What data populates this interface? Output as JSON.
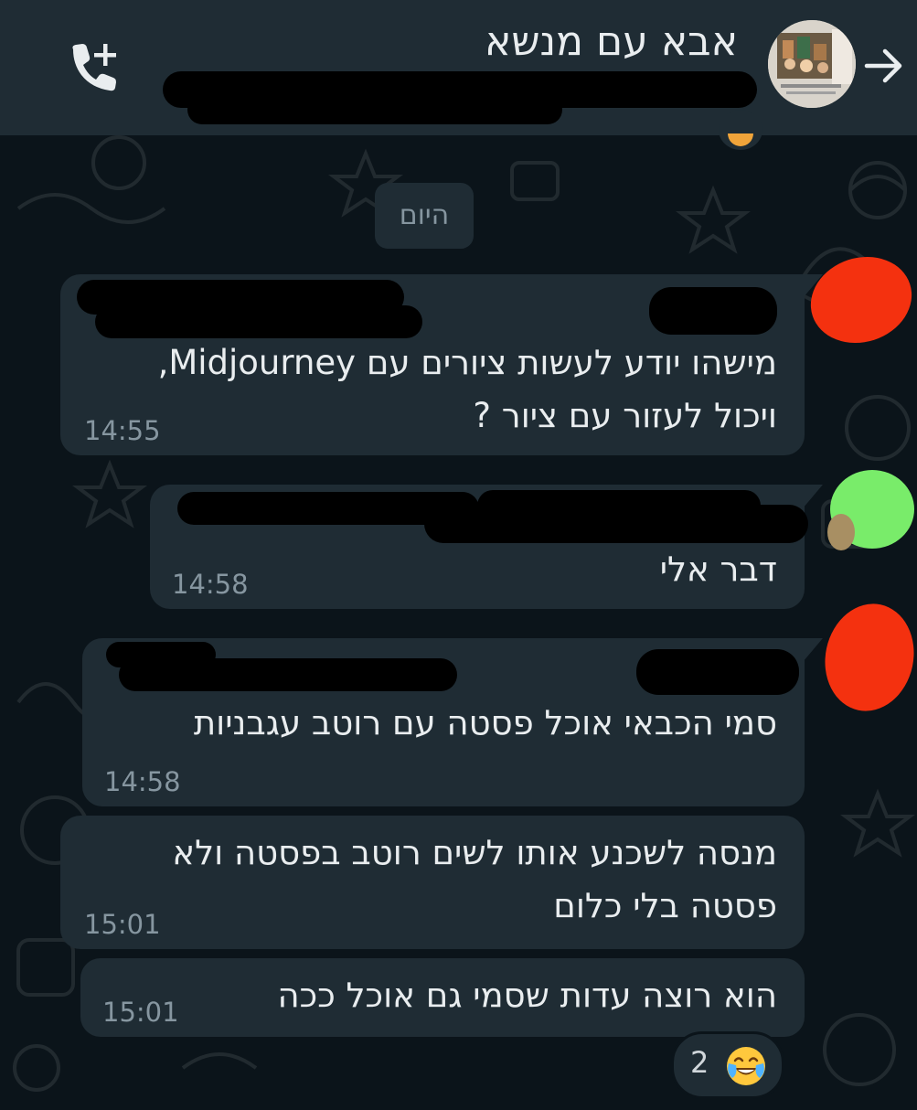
{
  "header": {
    "title": "אבא עם מנשא",
    "back_icon": "arrow-right-icon",
    "call_icon": "add-call-icon"
  },
  "date_chip": "היום",
  "messages": [
    {
      "lines": [
        "מישהו יודע לעשות ציורים עם Midjourney,",
        "ויכול לעזור עם ציור ?"
      ],
      "time": "14:55"
    },
    {
      "lines": [
        "דבר אלי"
      ],
      "time": "14:58"
    },
    {
      "lines": [
        "סמי הכבאי אוכל פסטה עם רוטב עגבניות"
      ],
      "time": "14:58"
    },
    {
      "lines": [
        "מנסה לשכנע אותו לשים רוטב בפסטה ולא",
        "פסטה בלי כלום"
      ],
      "time": "15:01"
    },
    {
      "lines": [
        "הוא רוצה עדות שסמי גם אוכל ככה"
      ],
      "time": "15:01"
    }
  ],
  "reaction": {
    "count": "2",
    "emoji": "face-with-tears-of-joy-icon"
  },
  "colors": {
    "background": "#0b141a",
    "bubble": "#1f2c34",
    "text": "#e9edef",
    "meta": "#8696a0",
    "redact_red": "#f4310f",
    "redact_green": "#79ec6a"
  }
}
